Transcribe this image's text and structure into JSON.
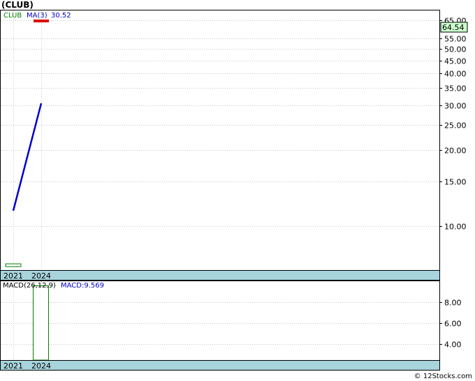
{
  "title": "(CLUB)",
  "credit": "© 12Stocks.com",
  "colors": {
    "price": "#008000",
    "ma": "#0000cc",
    "last_bar": "#dd0000",
    "price_label_bg": "#ccffcc",
    "date_strip": "#a8d4dc",
    "grid": "#c8c8c8",
    "macd": "#008000"
  },
  "chart_data": [
    {
      "type": "line",
      "panel": "price",
      "scale": "log",
      "ylim": [
        6.7,
        71
      ],
      "x_categories": [
        "2021",
        "2024"
      ],
      "yticks": [
        "10.00",
        "15.00",
        "20.00",
        "25.00",
        "30.00",
        "35.00",
        "40.00",
        "45.00",
        "50.00",
        "55.00",
        "65.00"
      ],
      "ytick_values": [
        10,
        15,
        20,
        25,
        30,
        35,
        40,
        45,
        50,
        55,
        65
      ],
      "grid": true,
      "series": [
        {
          "name": "CLUB",
          "label": "CLUB",
          "kind": "ohlc",
          "bars": [
            {
              "x": "2021",
              "open": 7.0,
              "high": 7.1,
              "low": 6.9,
              "close": 7.0
            },
            {
              "x": "2024",
              "open": 64.54,
              "high": 64.8,
              "low": 64.2,
              "close": 64.54
            }
          ]
        },
        {
          "name": "MA(3)",
          "label": "MA(3)",
          "value_label": "30.52",
          "kind": "line",
          "points": [
            {
              "x": "2021",
              "y": 11.5
            },
            {
              "x": "2024",
              "y": 30.52
            }
          ]
        }
      ],
      "last_price": "64.54",
      "last_price_value": 64.54
    },
    {
      "type": "bar",
      "panel": "macd",
      "ylim": [
        2.5,
        10.0
      ],
      "x_categories": [
        "2021",
        "2024"
      ],
      "yticks": [
        "4.00",
        "6.00",
        "8.00"
      ],
      "ytick_values": [
        4,
        6,
        8
      ],
      "grid": true,
      "label": "MACD(26,12,9)",
      "value_label": "MACD:9.569",
      "series": [
        {
          "name": "MACD",
          "values": [
            {
              "x": "2024",
              "y": 9.569
            }
          ]
        }
      ]
    }
  ]
}
